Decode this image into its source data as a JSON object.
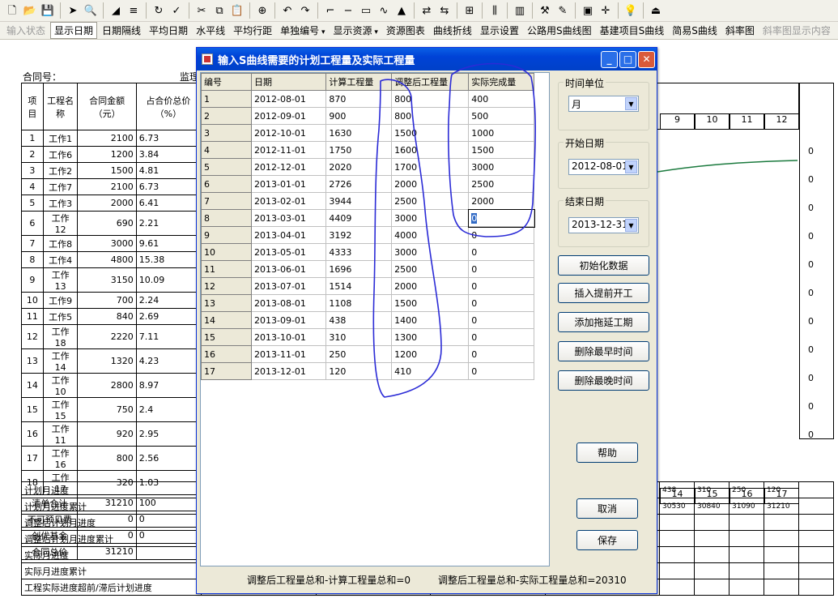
{
  "toolbar1": {
    "icons": [
      "new-file-icon",
      "open-folder-icon",
      "save-icon",
      "sep",
      "export-icon",
      "print-preview-icon",
      "sep",
      "triangle-icon",
      "bars-icon",
      "sep",
      "refresh-icon",
      "check-icon",
      "sep",
      "cut-icon",
      "copy-icon",
      "paste-icon",
      "sep",
      "binoculars-icon",
      "sep",
      "undo-icon",
      "redo-icon",
      "sep",
      "line-tool-icon",
      "minus-red-icon",
      "box-icon",
      "curve-icon",
      "tower-icon",
      "sep",
      "arrows-icon",
      "arrows2-icon",
      "sep",
      "chart-icon",
      "sep",
      "column-icon",
      "sep",
      "bar-chart-icon",
      "sep",
      "tools-icon",
      "pen-icon",
      "sep",
      "monitor-icon",
      "cross-icon",
      "sep",
      "bulb-icon",
      "sep",
      "exit-icon"
    ]
  },
  "toolbar2": {
    "items": [
      {
        "label": "输入状态",
        "state": "dis"
      },
      {
        "label": "显示日期",
        "state": "active"
      },
      {
        "label": "日期隔线",
        "state": ""
      },
      {
        "label": "平均日期",
        "state": ""
      },
      {
        "label": "水平线",
        "state": ""
      },
      {
        "label": "平均行距",
        "state": ""
      },
      {
        "label": "单独编号",
        "state": "dd"
      },
      {
        "label": "显示资源",
        "state": "dd"
      },
      {
        "label": "资源图表",
        "state": ""
      },
      {
        "label": "曲线折线",
        "state": ""
      },
      {
        "label": "显示设置",
        "state": ""
      },
      {
        "label": "公路用S曲线图",
        "state": ""
      },
      {
        "label": "基建项目S曲线",
        "state": ""
      },
      {
        "label": "简易S曲线",
        "state": ""
      },
      {
        "label": "斜率图",
        "state": ""
      },
      {
        "label": "斜率图显示内容",
        "state": "dis"
      }
    ]
  },
  "sheet": {
    "contract_label": "合同号：",
    "supervisor_label": "监理",
    "headers": {
      "item": "项目",
      "name": "工程名称",
      "amount": "合同金额（元）",
      "share": "占合价总价（%）"
    },
    "rows": [
      {
        "no": "1",
        "name": "工作1",
        "amount": "2100",
        "pct": "6.73"
      },
      {
        "no": "2",
        "name": "工作6",
        "amount": "1200",
        "pct": "3.84"
      },
      {
        "no": "3",
        "name": "工作2",
        "amount": "1500",
        "pct": "4.81"
      },
      {
        "no": "4",
        "name": "工作7",
        "amount": "2100",
        "pct": "6.73"
      },
      {
        "no": "5",
        "name": "工作3",
        "amount": "2000",
        "pct": "6.41"
      },
      {
        "no": "6",
        "name": "工作12",
        "amount": "690",
        "pct": "2.21"
      },
      {
        "no": "7",
        "name": "工作8",
        "amount": "3000",
        "pct": "9.61"
      },
      {
        "no": "8",
        "name": "工作4",
        "amount": "4800",
        "pct": "15.38"
      },
      {
        "no": "9",
        "name": "工作13",
        "amount": "3150",
        "pct": "10.09"
      },
      {
        "no": "10",
        "name": "工作9",
        "amount": "700",
        "pct": "2.24"
      },
      {
        "no": "11",
        "name": "工作5",
        "amount": "840",
        "pct": "2.69"
      },
      {
        "no": "12",
        "name": "工作18",
        "amount": "2220",
        "pct": "7.11"
      },
      {
        "no": "13",
        "name": "工作14",
        "amount": "1320",
        "pct": "4.23"
      },
      {
        "no": "14",
        "name": "工作10",
        "amount": "2800",
        "pct": "8.97"
      },
      {
        "no": "15",
        "name": "工作15",
        "amount": "750",
        "pct": "2.4"
      },
      {
        "no": "16",
        "name": "工作11",
        "amount": "920",
        "pct": "2.95"
      },
      {
        "no": "17",
        "name": "工作16",
        "amount": "800",
        "pct": "2.56"
      },
      {
        "no": "18",
        "name": "工作17",
        "amount": "320",
        "pct": "1.03"
      }
    ],
    "summary": [
      {
        "label": "清单合计",
        "amount": "31210",
        "pct": "100"
      },
      {
        "label": "不可预见费",
        "amount": "0",
        "pct": "0"
      },
      {
        "label": "创优基金",
        "amount": "0",
        "pct": "0"
      },
      {
        "label": "合同总价",
        "amount": "31210",
        "pct": ""
      }
    ],
    "bottom_rows": [
      "计划月进度",
      "计划月进度累计",
      "调整后计划月进度",
      "调整后计划月进度累计",
      "实际月进度",
      "实际月进度累计",
      "工程实际进度超前/滞后计划进度"
    ],
    "right_months_top": [
      "9",
      "10",
      "11",
      "12"
    ],
    "right_zeros": [
      "0",
      "0",
      "0",
      "0",
      "0",
      "0",
      "0",
      "0",
      "0",
      "0",
      "0"
    ],
    "right_months_bottom": [
      "14",
      "15",
      "16",
      "17"
    ],
    "plan_monthly": [
      "438",
      "310",
      "250",
      "120"
    ],
    "plan_cumulative": [
      "30530",
      "30840",
      "31090",
      "31210"
    ]
  },
  "dialog": {
    "title": "输入S曲线需要的计划工程量及实际工程量",
    "columns": [
      "编号",
      "日期",
      "计算工程量",
      "调整后工程量",
      "实际完成量"
    ],
    "rows": [
      {
        "no": "1",
        "date": "2012-08-01",
        "calc": "870",
        "adj": "800",
        "actual": "400"
      },
      {
        "no": "2",
        "date": "2012-09-01",
        "calc": "900",
        "adj": "800",
        "actual": "500"
      },
      {
        "no": "3",
        "date": "2012-10-01",
        "calc": "1630",
        "adj": "1500",
        "actual": "1000"
      },
      {
        "no": "4",
        "date": "2012-11-01",
        "calc": "1750",
        "adj": "1600",
        "actual": "1500"
      },
      {
        "no": "5",
        "date": "2012-12-01",
        "calc": "2020",
        "adj": "1700",
        "actual": "3000"
      },
      {
        "no": "6",
        "date": "2013-01-01",
        "calc": "2726",
        "adj": "2000",
        "actual": "2500"
      },
      {
        "no": "7",
        "date": "2013-02-01",
        "calc": "3944",
        "adj": "2500",
        "actual": "2000"
      },
      {
        "no": "8",
        "date": "2013-03-01",
        "calc": "4409",
        "adj": "3000",
        "actual": "0"
      },
      {
        "no": "9",
        "date": "2013-04-01",
        "calc": "3192",
        "adj": "4000",
        "actual": "0"
      },
      {
        "no": "10",
        "date": "2013-05-01",
        "calc": "4333",
        "adj": "3000",
        "actual": "0"
      },
      {
        "no": "11",
        "date": "2013-06-01",
        "calc": "1696",
        "adj": "2500",
        "actual": "0"
      },
      {
        "no": "12",
        "date": "2013-07-01",
        "calc": "1514",
        "adj": "2000",
        "actual": "0"
      },
      {
        "no": "13",
        "date": "2013-08-01",
        "calc": "1108",
        "adj": "1500",
        "actual": "0"
      },
      {
        "no": "14",
        "date": "2013-09-01",
        "calc": "438",
        "adj": "1400",
        "actual": "0"
      },
      {
        "no": "15",
        "date": "2013-10-01",
        "calc": "310",
        "adj": "1300",
        "actual": "0"
      },
      {
        "no": "16",
        "date": "2013-11-01",
        "calc": "250",
        "adj": "1200",
        "actual": "0"
      },
      {
        "no": "17",
        "date": "2013-12-01",
        "calc": "120",
        "adj": "410",
        "actual": "0"
      }
    ],
    "time_unit_label": "时间单位",
    "time_unit_value": "月",
    "start_label": "开始日期",
    "start_value": "2012-08-01",
    "end_label": "结束日期",
    "end_value": "2013-12-31",
    "buttons": {
      "init": "初始化数据",
      "insert": "插入提前开工",
      "add": "添加拖延工期",
      "del_first": "删除最早时间",
      "del_last": "删除最晚时间",
      "help": "帮助",
      "cancel": "取消",
      "save": "保存"
    },
    "status1": "调整后工程量总和-计算工程量总和=0",
    "status2": "调整后工程量总和-实际工程量总和=20310"
  }
}
